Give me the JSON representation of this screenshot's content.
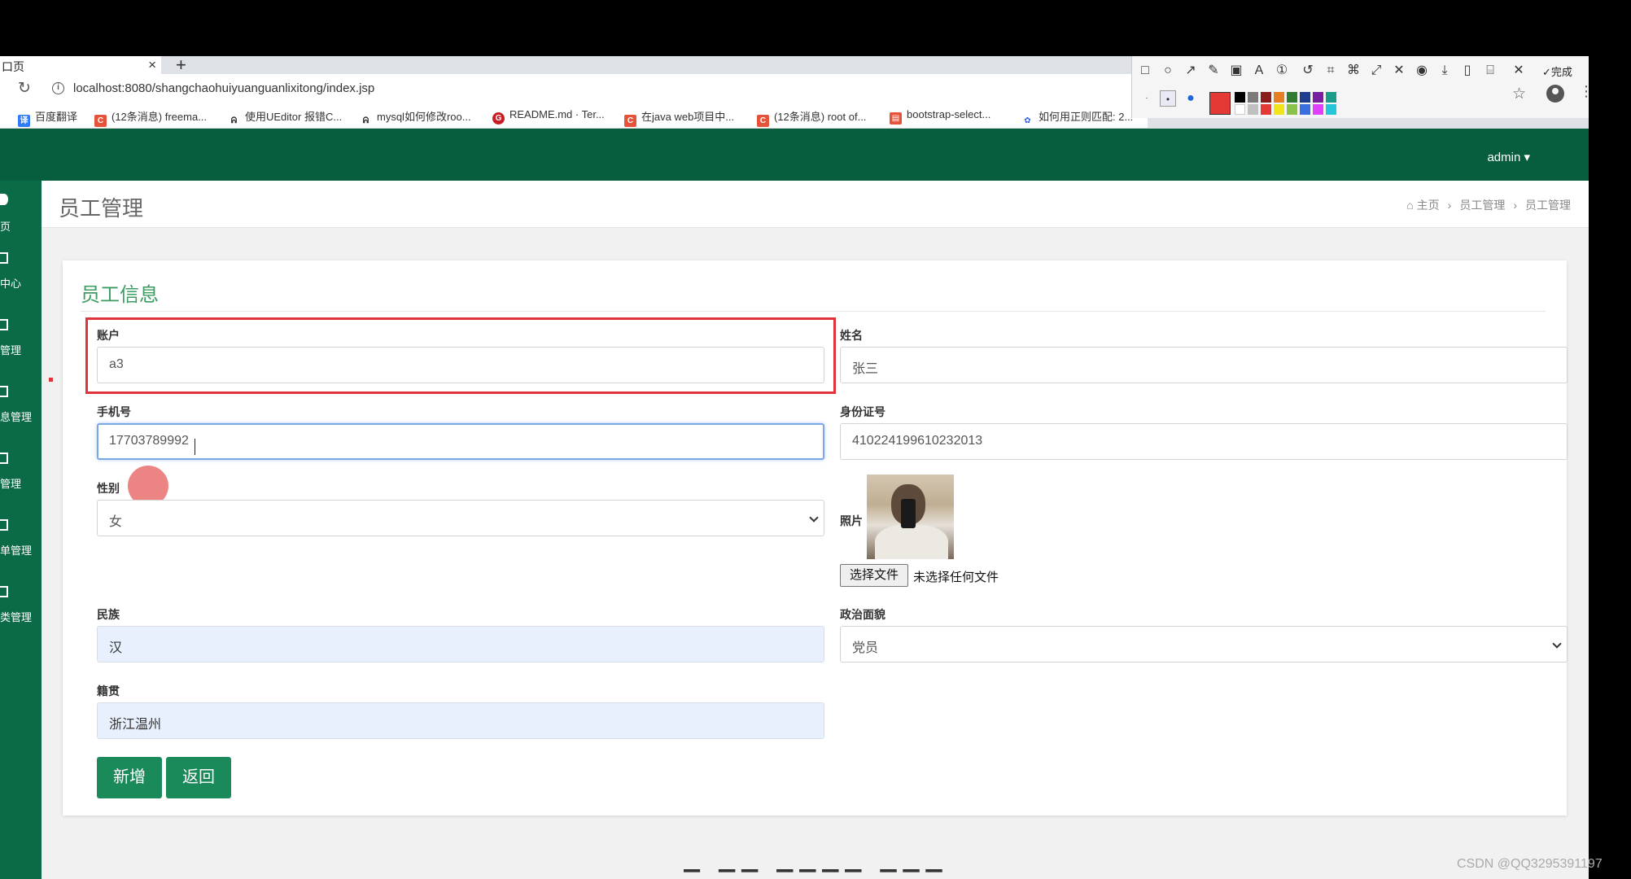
{
  "browser": {
    "tab_title": "口页",
    "tab_close": "×",
    "new_tab": "+",
    "url": "localhost:8080/shangchaohuiyuanguanlixitong/index.jsp",
    "bookmarks": [
      {
        "label": "百度翻译",
        "icon": "baidu-translate-icon"
      },
      {
        "label": "(12条消息) freema...",
        "icon": "csdn-icon"
      },
      {
        "label": "使用UEditor 报错C...",
        "icon": "bookmark-icon"
      },
      {
        "label": "mysql如何修改roo...",
        "icon": "bookmark-icon"
      },
      {
        "label": "README.md · Ter...",
        "icon": "gitee-icon"
      },
      {
        "label": "在java web项目中...",
        "icon": "csdn-icon"
      },
      {
        "label": "(12条消息) root of...",
        "icon": "csdn-icon"
      },
      {
        "label": "bootstrap-select...",
        "icon": "bookmark-icon"
      },
      {
        "label": "如何用正则匹配: 2...",
        "icon": "baidu-icon"
      }
    ],
    "capture_done": "完成"
  },
  "navbar": {
    "user_menu": "admin ▾"
  },
  "sidebar": {
    "items": [
      {
        "label": "页"
      },
      {
        "label": "中心"
      },
      {
        "label": "管理"
      },
      {
        "label": "息管理"
      },
      {
        "label": "管理"
      },
      {
        "label": "单管理"
      },
      {
        "label": "类管理"
      }
    ]
  },
  "page": {
    "title": "员工管理",
    "breadcrumb": {
      "home": "主页",
      "parent": "员工管理",
      "current": "员工管理",
      "separator": "›"
    }
  },
  "form": {
    "title": "员工信息",
    "account": {
      "label": "账户",
      "value": "a3"
    },
    "name": {
      "label": "姓名",
      "value": "张三"
    },
    "phone": {
      "label": "手机号",
      "value": "17703789992"
    },
    "id_number": {
      "label": "身份证号",
      "value": "410224199610232013"
    },
    "gender": {
      "label": "性别",
      "value": "女"
    },
    "photo": {
      "label": "照片",
      "choose_button": "选择文件",
      "status": "未选择任何文件"
    },
    "ethnicity": {
      "label": "民族",
      "value": "汉"
    },
    "political_status": {
      "label": "政治面貌",
      "value": "党员"
    },
    "native_place": {
      "label": "籍贯",
      "value": "浙江温州"
    },
    "add_button": "新增",
    "back_button": "返回"
  },
  "watermark": "CSDN @QQ3295391197",
  "colors": {
    "navbar": "#075e3f",
    "sidebar": "#0a6b46",
    "accent_green": "#3e9c62",
    "button": "#1a8a5a",
    "highlight_red": "#e0343a"
  }
}
